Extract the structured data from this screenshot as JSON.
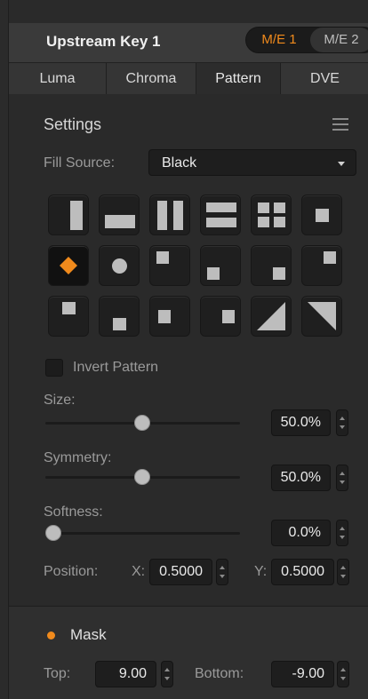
{
  "header": {
    "title": "Upstream Key 1",
    "me_options": [
      "M/E 1",
      "M/E 2"
    ],
    "me_selected": "M/E 1",
    "accent": "#f08a1c"
  },
  "tabs": [
    {
      "label": "Luma"
    },
    {
      "label": "Chroma"
    },
    {
      "label": "Pattern"
    },
    {
      "label": "DVE"
    }
  ],
  "active_tab": "Pattern",
  "settings": {
    "heading": "Settings",
    "menu_icon": "hamburger-icon",
    "fill_source_label": "Fill Source:",
    "fill_source_value": "Black"
  },
  "patterns": [
    "vertical-bar",
    "horizontal-bar",
    "vertical-barn-door",
    "horizontal-barn-door",
    "corners-4",
    "box",
    "diamond",
    "circle",
    "top-left-box",
    "bottom-left-box",
    "bottom-right-box",
    "top-right-box",
    "top-center-box",
    "bottom-center-box",
    "left-center-box",
    "right-center-box",
    "top-left-diagonal",
    "top-right-diagonal"
  ],
  "selected_pattern": "diamond",
  "invert_pattern": {
    "label": "Invert Pattern",
    "checked": false
  },
  "sliders": [
    {
      "id": "size",
      "label": "Size:",
      "value": "50.0%",
      "level": 0.5
    },
    {
      "id": "symmetry",
      "label": "Symmetry:",
      "value": "50.0%",
      "level": 0.5
    },
    {
      "id": "softness",
      "label": "Softness:",
      "value": "0.0%",
      "level": 0.0
    }
  ],
  "position": {
    "label": "Position:",
    "x_label": "X:",
    "x_value": "0.5000",
    "y_label": "Y:",
    "y_value": "0.5000"
  },
  "mask": {
    "label": "Mask",
    "enabled": true,
    "top_label": "Top:",
    "top_value": "9.00",
    "bottom_label": "Bottom:",
    "bottom_value": "-9.00"
  }
}
